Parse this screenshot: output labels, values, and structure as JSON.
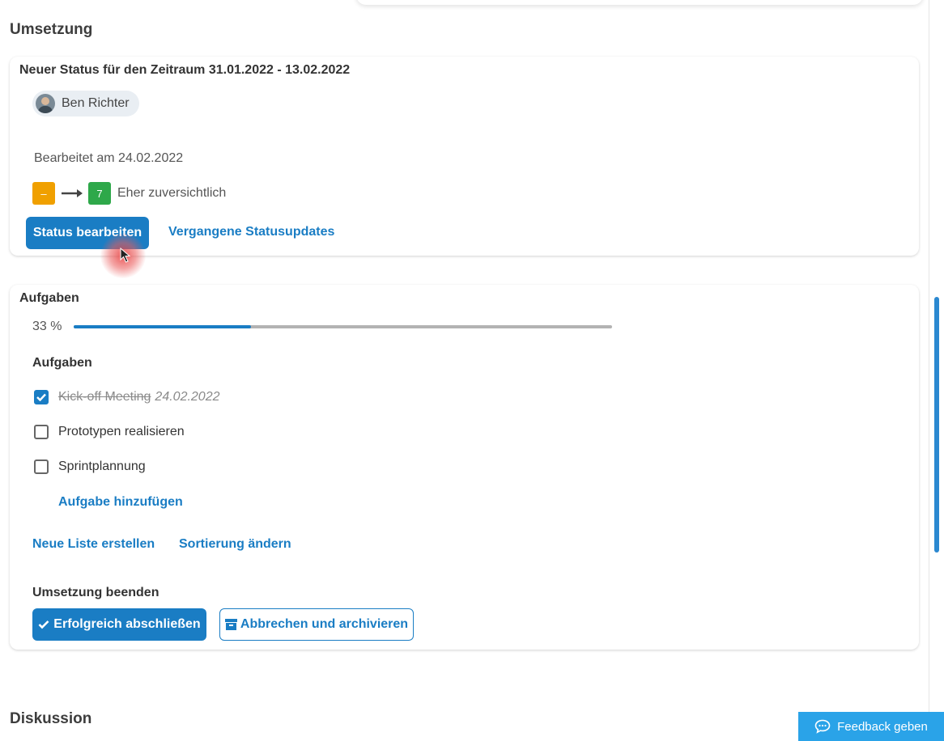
{
  "umsetzung": {
    "section_title": "Umsetzung",
    "status_card": {
      "heading": "Neuer Status für den Zeitraum 31.01.2022 - 13.02.2022",
      "user_name": "Ben Richter",
      "edited_text": "Bearbeitet am 24.02.2022",
      "previous_status": "–",
      "previous_status_color": "#f0a000",
      "new_status": "7",
      "new_status_color": "#2ea84a",
      "status_text": "Eher zuversichtlich",
      "edit_button": "Status bearbeiten",
      "past_updates_link": "Vergangene Statusupdates"
    }
  },
  "tasks_card": {
    "heading": "Aufgaben",
    "progress_label": "33 %",
    "progress_value": 0.33,
    "list_title": "Aufgaben",
    "tasks": [
      {
        "label": "Kick-off Meeting",
        "date": "24.02.2022",
        "done": true
      },
      {
        "label": "Prototypen realisieren",
        "done": false
      },
      {
        "label": "Sprintplannung",
        "done": false
      }
    ],
    "add_task_link": "Aufgabe hinzufügen",
    "new_list_link": "Neue Liste erstellen",
    "sort_link": "Sortierung ändern",
    "finish_title": "Umsetzung beenden",
    "complete_button": "Erfolgreich abschließen",
    "archive_button": "Abbrechen und archivieren"
  },
  "discussion": {
    "section_title": "Diskussion"
  },
  "feedback_button": "Feedback geben",
  "colors": {
    "accent": "#1a7dc4",
    "feedback": "#2aa3e8"
  }
}
